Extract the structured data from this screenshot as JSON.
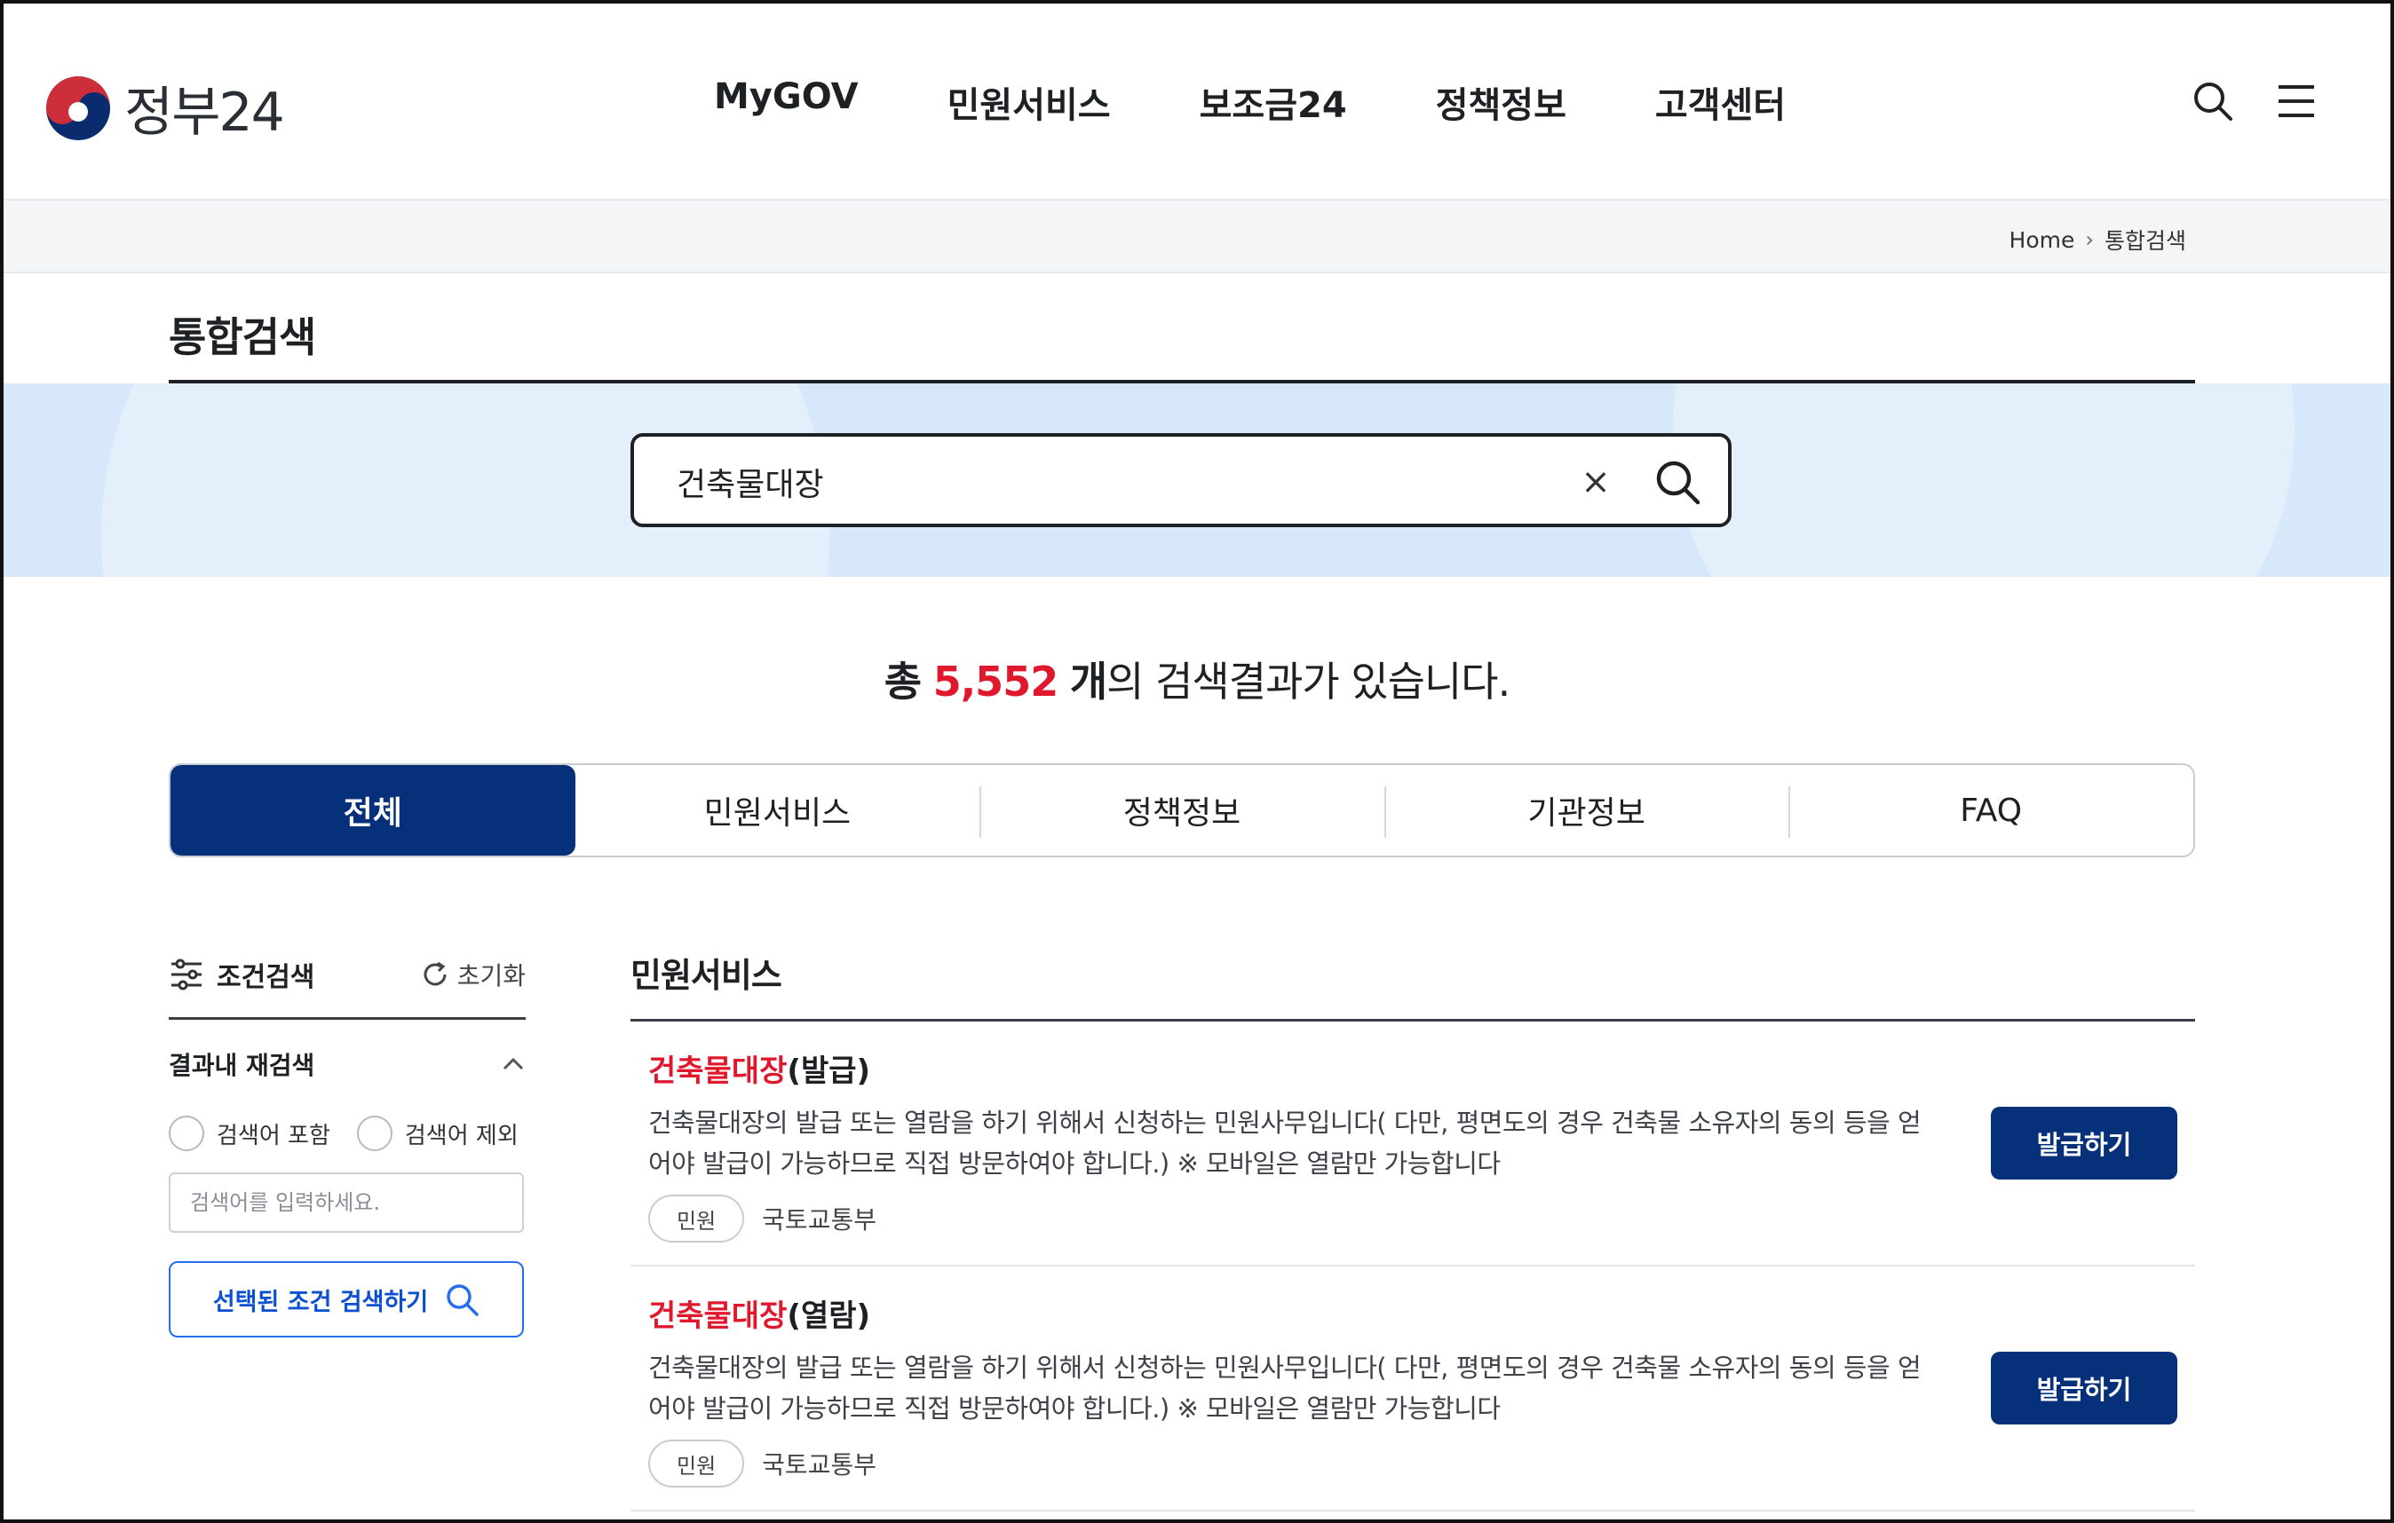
{
  "header": {
    "logo_text": "정부24",
    "nav": [
      "MyGOV",
      "민원서비스",
      "보조금24",
      "정책정보",
      "고객센터"
    ],
    "icons": [
      "search-icon",
      "menu-icon"
    ]
  },
  "breadcrumb": {
    "home": "Home",
    "current": "통합검색"
  },
  "page": {
    "title": "통합검색"
  },
  "search": {
    "value": "건축물대장",
    "clear_label": "×"
  },
  "summary": {
    "prefix": "총",
    "count": "5,552",
    "unit": "개",
    "suffix": "의 검색결과가 있습니다."
  },
  "tabs": [
    {
      "label": "전체",
      "active": true
    },
    {
      "label": "민원서비스",
      "active": false
    },
    {
      "label": "정책정보",
      "active": false
    },
    {
      "label": "기관정보",
      "active": false
    },
    {
      "label": "FAQ",
      "active": false
    }
  ],
  "sidebar": {
    "title": "조건검색",
    "reset_label": "초기화",
    "refine_title": "결과내 재검색",
    "options": [
      "검색어 포함",
      "검색어 제외"
    ],
    "input_placeholder": "검색어를 입력하세요.",
    "submit_label": "선택된 조건 검색하기"
  },
  "results": {
    "section_title": "민원서비스",
    "items": [
      {
        "title_highlight": "건축물대장",
        "title_rest": "(발급)",
        "desc_line1": "건축물대장의 발급 또는 열람을 하기 위해서 신청하는 민원사무입니다( 다만, 평면도의 경우 건축물 소유자의 동의 등을 얻",
        "desc_line2": "어야 발급이 가능하므로 직접 방문하여야 합니다.) ※ 모바일은 열람만 가능합니다",
        "tag": "민원",
        "org": "국토교통부",
        "button": "발급하기"
      },
      {
        "title_highlight": "건축물대장",
        "title_rest": "(열람)",
        "desc_line1": "건축물대장의 발급 또는 열람을 하기 위해서 신청하는 민원사무입니다( 다만, 평면도의 경우 건축물 소유자의 동의 등을 얻",
        "desc_line2": "어야 발급이 가능하므로 직접 방문하여야 합니다.) ※ 모바일은 열람만 가능합니다",
        "tag": "민원",
        "org": "국토교통부",
        "button": "발급하기"
      }
    ]
  },
  "colors": {
    "primary": "#063079",
    "highlight": "#e0182d",
    "band": "#d7e8fb",
    "accent": "#256ef4"
  }
}
